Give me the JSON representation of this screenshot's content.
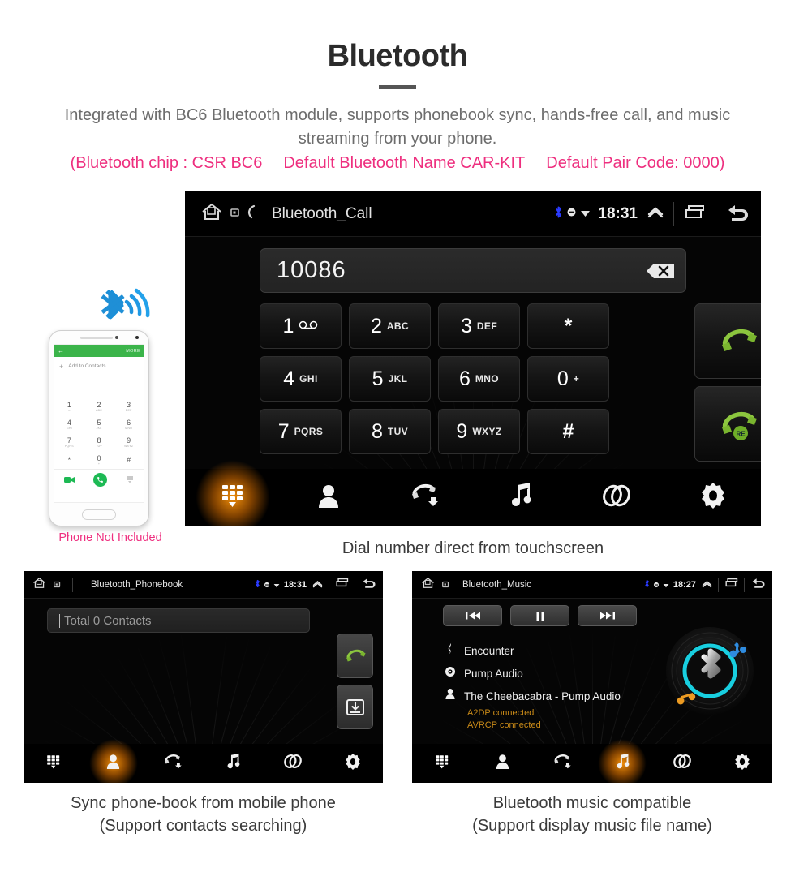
{
  "header": {
    "title": "Bluetooth",
    "subtitle": "Integrated with BC6 Bluetooth module, supports phonebook sync, hands-free call, and music streaming from your phone.",
    "spec_chip": "(Bluetooth chip : CSR BC6",
    "spec_name": "Default Bluetooth Name CAR-KIT",
    "spec_code": "Default Pair Code: 0000)",
    "accent_pink": "#ee2f7f"
  },
  "phone_mock": {
    "note": "Phone Not Included",
    "app_bar_more": "MORE",
    "add_to_contacts": "Add to Contacts",
    "keys": [
      {
        "d": "1",
        "l": "∞"
      },
      {
        "d": "2",
        "l": "ABC"
      },
      {
        "d": "3",
        "l": "DEF"
      },
      {
        "d": "4",
        "l": "GHI"
      },
      {
        "d": "5",
        "l": "JKL"
      },
      {
        "d": "6",
        "l": "MNO"
      },
      {
        "d": "7",
        "l": "PQRS"
      },
      {
        "d": "8",
        "l": "TUV"
      },
      {
        "d": "9",
        "l": "WXYZ"
      },
      {
        "d": "*",
        "l": ""
      },
      {
        "d": "0",
        "l": "+"
      },
      {
        "d": "#",
        "l": ""
      }
    ]
  },
  "call_screen": {
    "status": {
      "title": "Bluetooth_Call",
      "clock": "18:31",
      "icons": [
        "home-icon",
        "recent-icon",
        "call-icon",
        "bluetooth-icon",
        "mute-icon",
        "wifi-icon",
        "expand-up-icon",
        "windows-icon",
        "back-icon"
      ]
    },
    "number": "10086",
    "backspace_label": "×",
    "keypad": [
      [
        {
          "digit": "1",
          "letters": "voicemail"
        },
        {
          "digit": "2",
          "letters": "ABC"
        },
        {
          "digit": "3",
          "letters": "DEF"
        },
        {
          "digit": "*",
          "letters": ""
        }
      ],
      [
        {
          "digit": "4",
          "letters": "GHI"
        },
        {
          "digit": "5",
          "letters": "JKL"
        },
        {
          "digit": "6",
          "letters": "MNO"
        },
        {
          "digit": "0",
          "letters": "+"
        }
      ],
      [
        {
          "digit": "7",
          "letters": "PQRS"
        },
        {
          "digit": "8",
          "letters": "TUV"
        },
        {
          "digit": "9",
          "letters": "WXYZ"
        },
        {
          "digit": "#",
          "letters": ""
        }
      ]
    ],
    "call_button": "call-icon",
    "redial_button": "redial-icon",
    "redial_badge": "RE",
    "caption": "Dial number direct from touchscreen"
  },
  "phonebook_screen": {
    "status": {
      "title": "Bluetooth_Phonebook",
      "clock": "18:31"
    },
    "search_placeholder": "Total 0 Contacts",
    "side_buttons": [
      "call-icon",
      "download-contacts-icon"
    ],
    "caption_line1": "Sync phone-book from mobile phone",
    "caption_line2": "(Support contacts searching)"
  },
  "music_screen": {
    "status": {
      "title": "Bluetooth_Music",
      "clock": "18:27"
    },
    "transport": [
      "previous-icon",
      "pause-icon",
      "next-icon"
    ],
    "track_title": "Encounter",
    "album": "Pump Audio",
    "artist": "The Cheebacabra - Pump Audio",
    "profile_a2dp": "A2DP connected",
    "profile_avrcp": "AVRCP connected",
    "caption_line1": "Bluetooth music compatible",
    "caption_line2": "(Support display music file name)"
  },
  "nav": {
    "items": [
      {
        "name": "dialpad",
        "icon": "dialpad-icon"
      },
      {
        "name": "contacts",
        "icon": "person-icon"
      },
      {
        "name": "call-log",
        "icon": "call-log-icon"
      },
      {
        "name": "music",
        "icon": "music-note-icon"
      },
      {
        "name": "link",
        "icon": "link-icon"
      },
      {
        "name": "settings",
        "icon": "gear-icon"
      }
    ],
    "active_call": 0,
    "active_phonebook": 1,
    "active_music": 3,
    "active_color": "#ff8c00"
  }
}
